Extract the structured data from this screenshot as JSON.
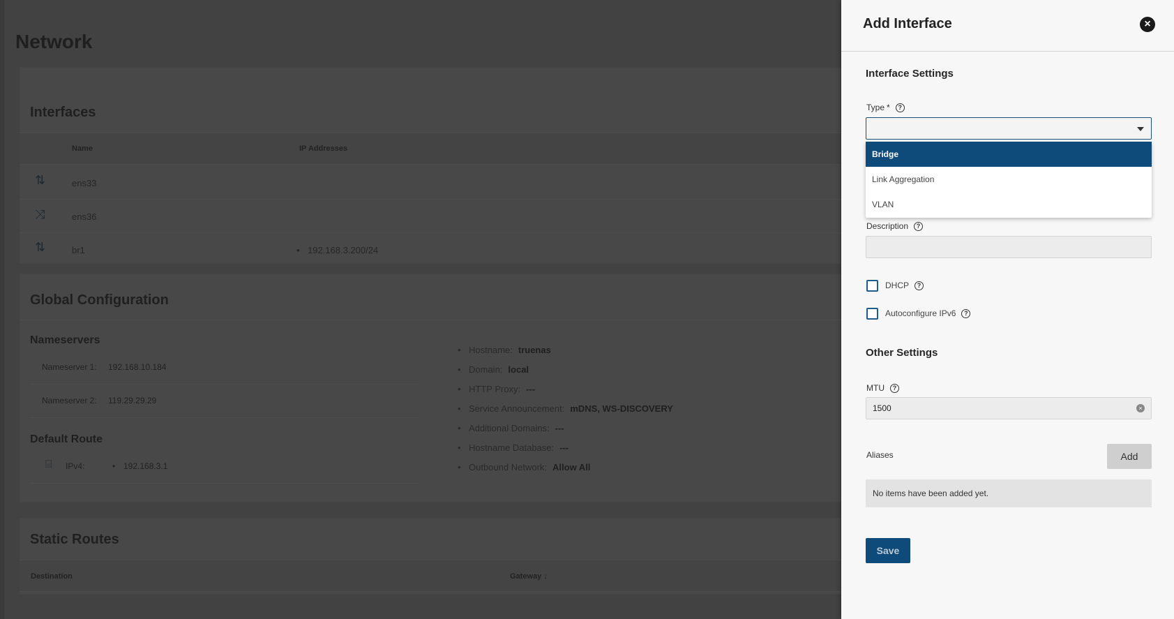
{
  "background": {
    "page_title": "Network",
    "interfaces": {
      "title": "Interfaces",
      "columns": [
        "Name",
        "IP Addresses"
      ],
      "rows": [
        {
          "name": "ens33",
          "ip": ""
        },
        {
          "name": "ens36",
          "ip": ""
        },
        {
          "name": "br1",
          "ip": "192.168.3.200/24"
        }
      ]
    },
    "global_config": {
      "title": "Global Configuration",
      "nameservers_title": "Nameservers",
      "nameserver1_label": "Nameserver 1:",
      "nameserver1_value": "192.168.10.184",
      "nameserver2_label": "Nameserver 2:",
      "nameserver2_value": "119.29.29.29",
      "default_route_title": "Default Route",
      "ipv4_label": "IPv4:",
      "ipv4_value": "192.168.3.1",
      "items": [
        {
          "label": "Hostname:",
          "value": "truenas"
        },
        {
          "label": "Domain:",
          "value": "local"
        },
        {
          "label": "HTTP Proxy:",
          "value": "---"
        },
        {
          "label": "Service Announcement:",
          "value": "mDNS, WS-DISCOVERY"
        },
        {
          "label": "Additional Domains:",
          "value": "---"
        },
        {
          "label": "Hostname Database:",
          "value": "---"
        },
        {
          "label": "Outbound Network:",
          "value": "Allow All"
        }
      ]
    },
    "static_routes": {
      "title": "Static Routes",
      "columns": [
        "Destination",
        "Gateway"
      ]
    }
  },
  "drawer": {
    "title": "Add Interface",
    "interface_settings_title": "Interface Settings",
    "type_label": "Type",
    "required_mark": "*",
    "type_value": "",
    "type_options": [
      "Bridge",
      "Link Aggregation",
      "VLAN"
    ],
    "description_label": "Description",
    "description_value": "",
    "dhcp_label": "DHCP",
    "autoconfig_label": "Autoconfigure IPv6",
    "other_settings_title": "Other Settings",
    "mtu_label": "MTU",
    "mtu_value": "1500",
    "aliases_label": "Aliases",
    "add_label": "Add",
    "empty_text": "No items have been added yet.",
    "save_label": "Save"
  }
}
